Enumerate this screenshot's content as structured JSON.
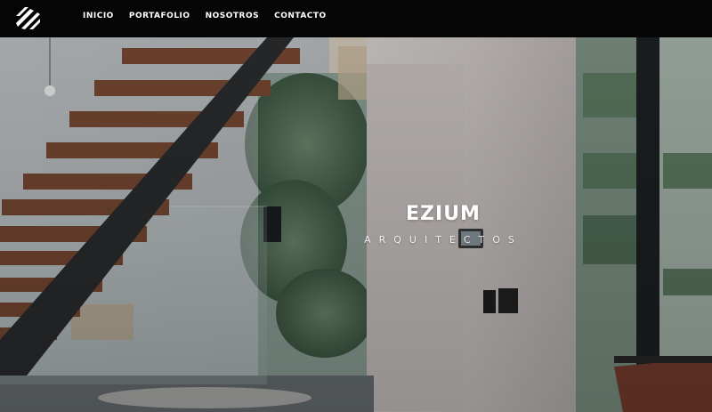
{
  "nav": {
    "items": [
      {
        "label": "INICIO"
      },
      {
        "label": "PORTAFOLIO"
      },
      {
        "label": "NOSOTROS"
      },
      {
        "label": "CONTACTO"
      }
    ]
  },
  "hero": {
    "title": "EZIUM",
    "subtitle": "ARQUITECTOS"
  },
  "colors": {
    "topbar": "#050505",
    "text": "#ffffff",
    "wood": "#7a4a34"
  },
  "icons": {
    "logo": "ezium-stripes-logo-icon"
  }
}
